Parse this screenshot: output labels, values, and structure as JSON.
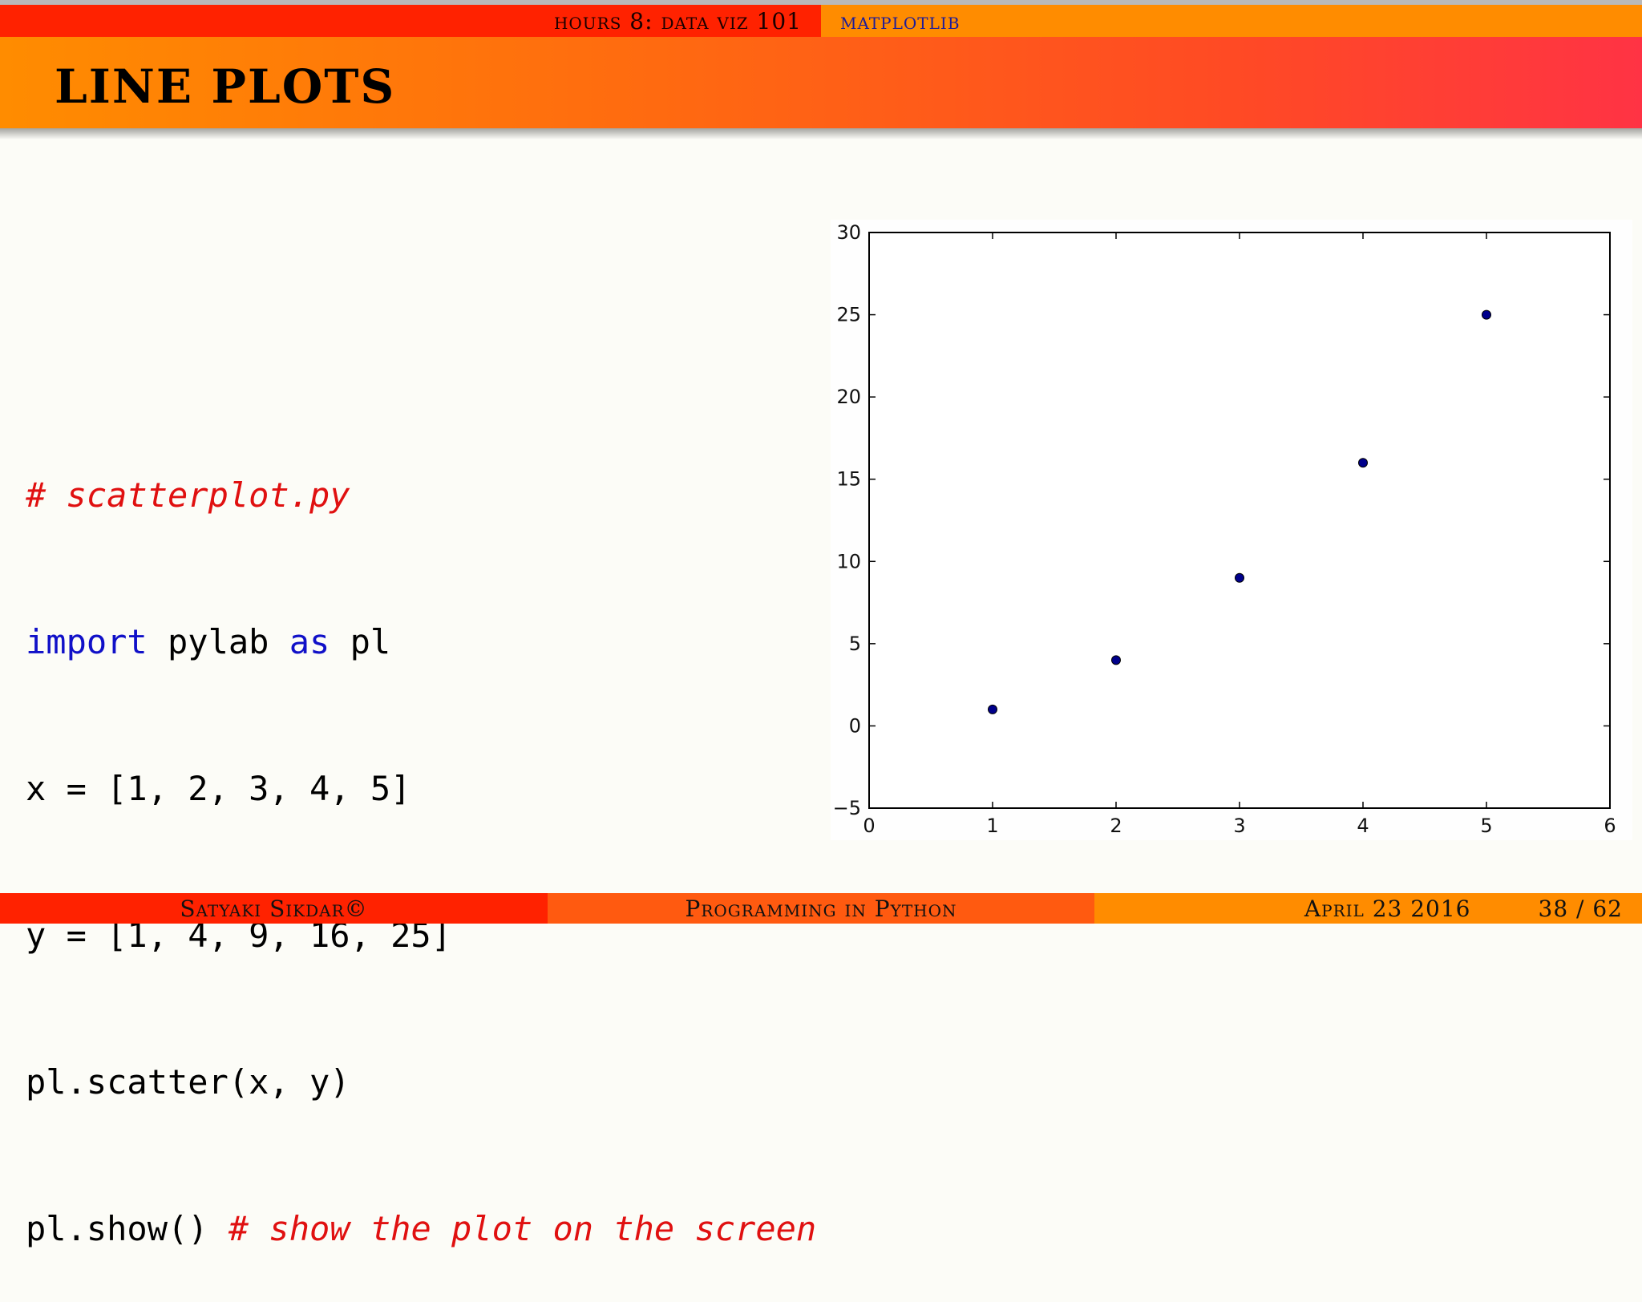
{
  "header": {
    "section": "hours 8: data viz 101",
    "subsection": "matplotlib"
  },
  "slide": {
    "title": "LINE PLOTS"
  },
  "code": {
    "line1_comment": "# scatterplot.py",
    "line2_kw1": "import",
    "line2_text1": " pylab ",
    "line2_kw2": "as",
    "line2_text2": " pl",
    "line3": "x = [1, 2, 3, 4, 5]",
    "line4": "y = [1, 4, 9, 16, 25]",
    "line5": "pl.scatter(x, y)",
    "line6_code": "pl.show() ",
    "line6_comment": "# show the plot on the screen"
  },
  "chart_data": {
    "type": "scatter",
    "x": [
      1,
      2,
      3,
      4,
      5
    ],
    "y": [
      1,
      4,
      9,
      16,
      25
    ],
    "xlim": [
      0,
      6
    ],
    "ylim": [
      -5,
      30
    ],
    "xticks": [
      "0",
      "1",
      "2",
      "3",
      "4",
      "5",
      "6"
    ],
    "yticks": [
      "−5",
      "0",
      "5",
      "10",
      "15",
      "20",
      "25",
      "30"
    ],
    "marker_color": "#00008b"
  },
  "footer": {
    "author": "Satyaki Sikdar©",
    "course": "Programming in Python",
    "date": "April 23 2016",
    "page": "38 / 62"
  }
}
